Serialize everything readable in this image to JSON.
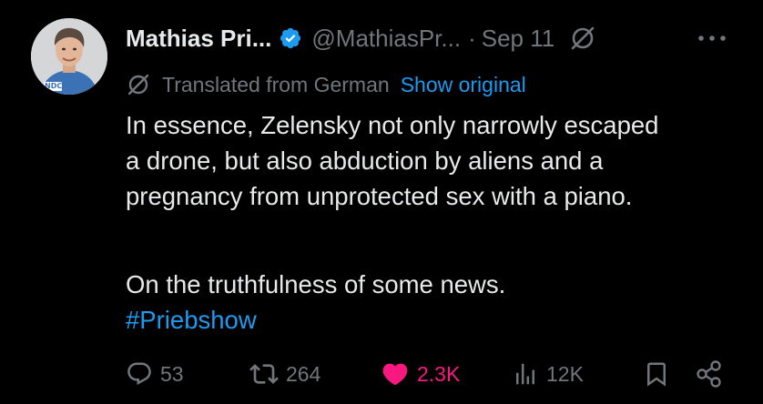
{
  "author": {
    "name": "Mathias Pri...",
    "handle": "@MathiasPr...",
    "date": "Sep 11",
    "avatar_badge": "NDC"
  },
  "translation": {
    "label": "Translated from German",
    "link": "Show original"
  },
  "tweet": {
    "lines": [
      "In essence, Zelensky not only narrowly escaped",
      "a drone, but also abduction by aliens and a",
      "pregnancy from unprotected sex with a piano."
    ],
    "closing": "On the truthfulness of some news.",
    "hashtag": "#Priebshow"
  },
  "actions": {
    "replies": "53",
    "reposts": "264",
    "likes": "2.3K",
    "views": "12K"
  },
  "colors": {
    "background": "#000000",
    "text": "#e7e9ea",
    "muted": "#71767b",
    "link": "#1d9bf0",
    "like": "#f91880",
    "verified": "#1d9bf0"
  },
  "icons": [
    "verified-badge-icon",
    "grok-icon",
    "more-icon",
    "translate-icon",
    "reply-icon",
    "repost-icon",
    "like-icon",
    "views-icon",
    "bookmark-icon",
    "share-icon"
  ]
}
